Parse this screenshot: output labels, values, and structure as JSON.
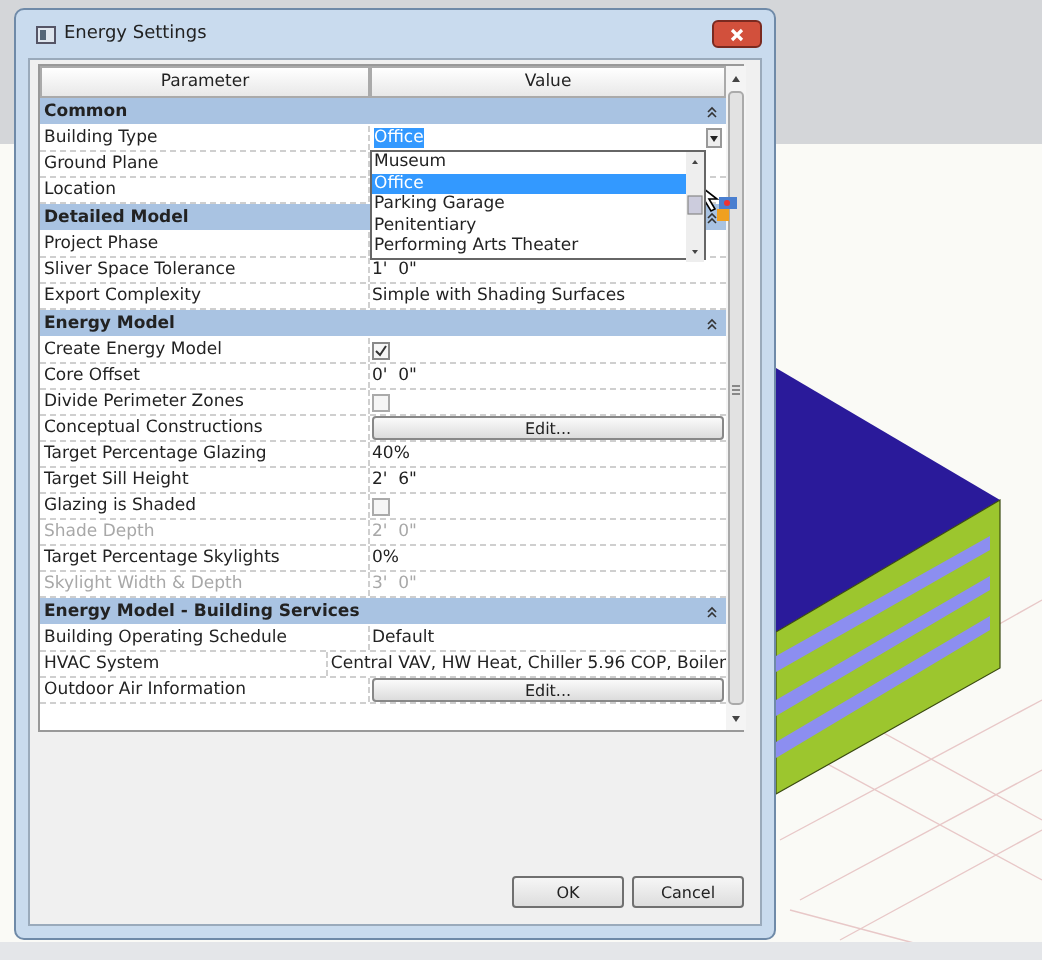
{
  "window": {
    "title": "Energy Settings"
  },
  "table": {
    "columns": [
      "Parameter",
      "Value"
    ],
    "groups": [
      {
        "title": "Common",
        "rows": [
          {
            "parameter": "Building Type",
            "kind": "combo",
            "value": "Office",
            "focused": true,
            "open": true,
            "disabled": false,
            "options": [
              {
                "label": "Museum",
                "selected": false
              },
              {
                "label": "Office",
                "selected": true
              },
              {
                "label": "Parking Garage",
                "selected": false
              },
              {
                "label": "Penitentiary",
                "selected": false
              },
              {
                "label": "Performing Arts Theater",
                "selected": false
              }
            ]
          },
          {
            "parameter": "Ground Plane",
            "kind": "text",
            "disabled": false
          },
          {
            "parameter": "Location",
            "kind": "text",
            "disabled": false
          }
        ]
      },
      {
        "title": "Detailed Model",
        "rows": [
          {
            "parameter": "Project Phase",
            "kind": "text",
            "disabled": false
          },
          {
            "parameter": "Sliver Space Tolerance",
            "kind": "text",
            "value": "1'  0\"",
            "disabled": false
          },
          {
            "parameter": "Export Complexity",
            "kind": "text",
            "value": "Simple with Shading Surfaces",
            "disabled": false
          }
        ]
      },
      {
        "title": "Energy Model",
        "rows": [
          {
            "parameter": "Create Energy Model",
            "kind": "checkbox",
            "checked": true,
            "disabled": false
          },
          {
            "parameter": "Core Offset",
            "kind": "text",
            "value": "0'  0\"",
            "disabled": false
          },
          {
            "parameter": "Divide Perimeter Zones",
            "kind": "checkbox",
            "checked": false,
            "disabled": false
          },
          {
            "parameter": "Conceptual Constructions",
            "kind": "button",
            "value": "Edit...",
            "disabled": false
          },
          {
            "parameter": "Target Percentage Glazing",
            "kind": "text",
            "value": "40%",
            "disabled": false
          },
          {
            "parameter": "Target Sill Height",
            "kind": "text",
            "value": "2'  6\"",
            "disabled": false
          },
          {
            "parameter": "Glazing is Shaded",
            "kind": "checkbox",
            "checked": false,
            "disabled": false
          },
          {
            "parameter": "Shade Depth",
            "kind": "text",
            "value": "2'  0\"",
            "disabled": true
          },
          {
            "parameter": "Target Percentage Skylights",
            "kind": "text",
            "value": "0%",
            "disabled": false
          },
          {
            "parameter": "Skylight Width & Depth",
            "kind": "text",
            "value": "3'  0\"",
            "disabled": true
          }
        ]
      },
      {
        "title": "Energy Model - Building Services",
        "rows": [
          {
            "parameter": "Building Operating Schedule",
            "kind": "text",
            "value": "Default",
            "disabled": false
          },
          {
            "parameter": "HVAC System",
            "kind": "text",
            "value": "Central VAV, HW Heat, Chiller 5.96 COP, Boiler",
            "disabled": false
          },
          {
            "parameter": "Outdoor Air Information",
            "kind": "button",
            "value": "Edit...",
            "disabled": false
          }
        ]
      }
    ]
  },
  "buttons": [
    "OK",
    "Cancel"
  ]
}
